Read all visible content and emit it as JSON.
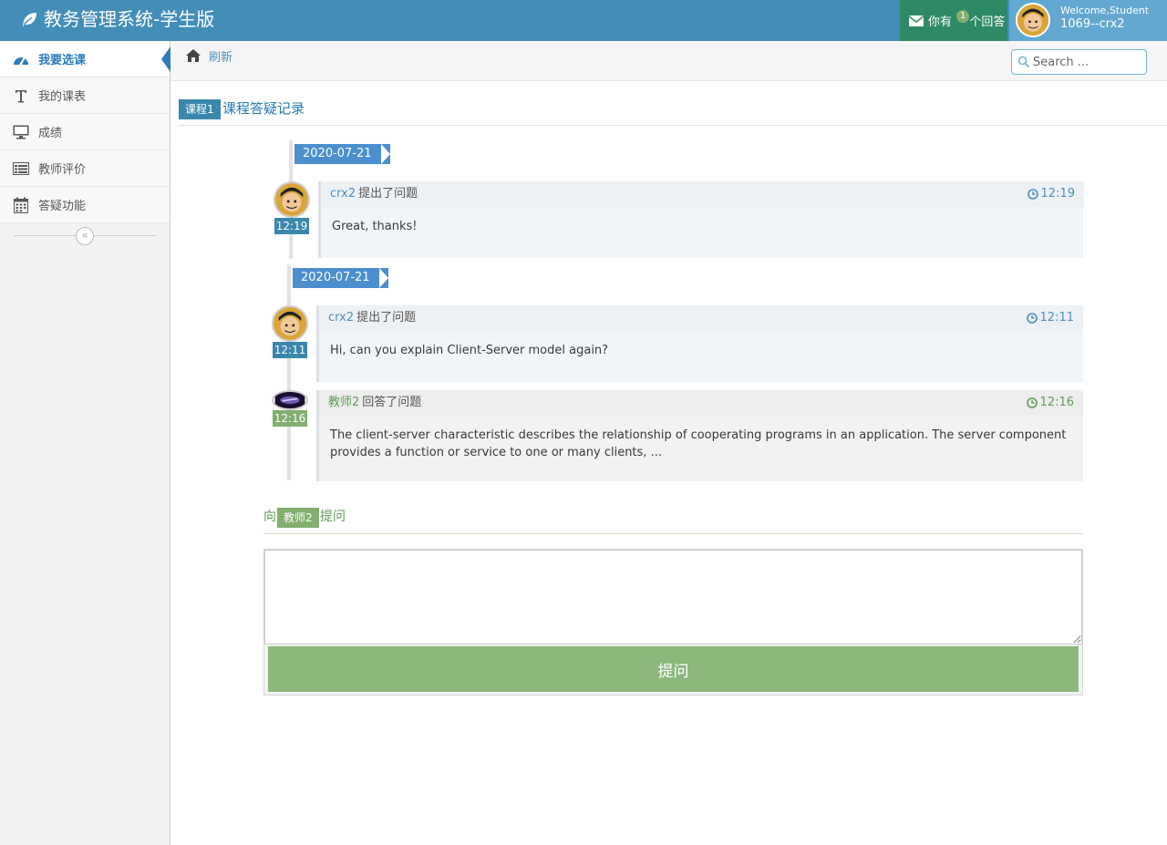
{
  "navbar": {
    "brand": "教务管理系统-学生版",
    "messages_prefix": "你有",
    "messages_count": "1",
    "messages_suffix": "个回答",
    "welcome": "Welcome,Student",
    "user_name": "1069--crx2"
  },
  "sidebar": {
    "items": [
      {
        "label": "我要选课",
        "icon": "dashboard-icon",
        "active": true
      },
      {
        "label": "我的课表",
        "icon": "text-icon"
      },
      {
        "label": "成绩",
        "icon": "desktop-icon"
      },
      {
        "label": "教师评价",
        "icon": "list-icon"
      },
      {
        "label": "答疑功能",
        "icon": "calendar-icon"
      }
    ],
    "collapse_icon": "double-angle-left-icon"
  },
  "breadcrumbs": {
    "refresh_label": "刷新",
    "search_placeholder": "Search ..."
  },
  "page": {
    "course_badge": "课程1",
    "title": "课程答疑记录"
  },
  "timeline": [
    {
      "date": "2020-07-21",
      "items": [
        {
          "time": "12:19",
          "who": "crx2",
          "action": "提出了问题",
          "text": "Great, thanks!",
          "role": "student"
        }
      ]
    },
    {
      "date": "2020-07-21",
      "items": [
        {
          "time": "12:11",
          "who": "crx2",
          "action": "提出了问题",
          "text": "Hi, can you explain Client-Server model again?",
          "role": "student"
        },
        {
          "time": "12:16",
          "who": "教师2",
          "action": "回答了问题",
          "text": "The client-server characteristic describes the relationship of cooperating programs in an application. The server component provides a function or service to one or many clients, ...",
          "role": "teacher"
        }
      ]
    }
  ],
  "ask": {
    "prefix": "向",
    "teacher": "教师2",
    "suffix": "提问",
    "button_label": "提问"
  },
  "colors": {
    "navbar": "#438eb9",
    "accent_blue": "#4c8fbd",
    "accent_green": "#82af6f"
  }
}
